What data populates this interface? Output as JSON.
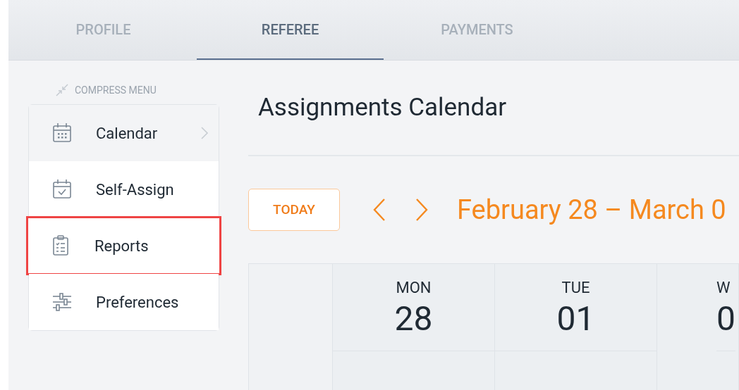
{
  "tabs": [
    {
      "label": "PROFILE",
      "selected": false
    },
    {
      "label": "REFEREE",
      "selected": true
    },
    {
      "label": "PAYMENTS",
      "selected": false
    }
  ],
  "compress_menu": "COMPRESS MENU",
  "menu": [
    {
      "label": "Calendar",
      "hovered": true,
      "has_submenu": true,
      "highlighted": false
    },
    {
      "label": "Self-Assign",
      "hovered": false,
      "has_submenu": false,
      "highlighted": false
    },
    {
      "label": "Reports",
      "hovered": false,
      "has_submenu": false,
      "highlighted": true
    },
    {
      "label": "Preferences",
      "hovered": false,
      "has_submenu": false,
      "highlighted": false
    }
  ],
  "title": "Assignments Calendar",
  "today_button": "TODAY",
  "date_range": "February 28 – March 0",
  "days": [
    {
      "day": "MON",
      "date": "28"
    },
    {
      "day": "TUE",
      "date": "01"
    },
    {
      "day": "W",
      "date": "0"
    }
  ]
}
